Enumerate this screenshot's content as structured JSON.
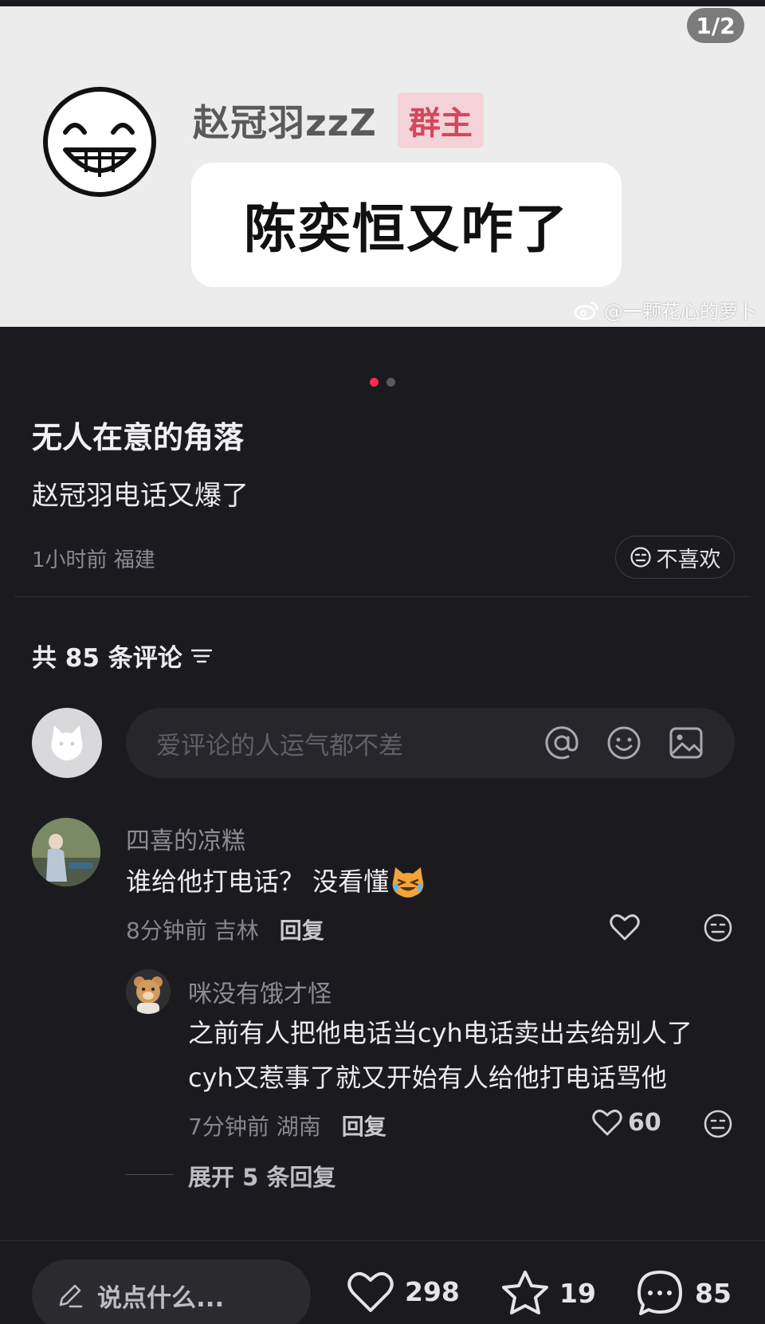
{
  "carousel": {
    "page_counter": "1/2",
    "meme": {
      "name": "赵冠羽zzZ",
      "badge": "群主",
      "bubble_text": "陈奕恒又咋了",
      "watermark": "@一颗花心的萝卜"
    },
    "dot_count": 2,
    "active_dot": 0
  },
  "post": {
    "title": "无人在意的角落",
    "body": "赵冠羽电话又爆了",
    "meta": "1小时前 福建",
    "dislike_label": "不喜欢"
  },
  "comments_header": {
    "label": "共 85 条评论"
  },
  "comment_input": {
    "placeholder": "爱评论的人运气都不差"
  },
  "comments": [
    {
      "author": "四喜的凉糕",
      "text": "谁给他打电话？ 没看懂",
      "time": "8分钟前 吉林",
      "reply": "回复",
      "likes": "",
      "emoji": "cat-crying-laughing-emoji"
    }
  ],
  "replies": [
    {
      "author": "咪没有饿才怪",
      "line1": "之前有人把他电话当cyh电话卖出去给别人了",
      "line2": "cyh又惹事了就又开始有人给他打电话骂他",
      "time": "7分钟前 湖南",
      "reply": "回复",
      "likes": "60"
    }
  ],
  "expand": {
    "label": "展开 5 条回复"
  },
  "bottom_bar": {
    "say_placeholder": "说点什么...",
    "likes": "298",
    "favorites": "19",
    "comments": "85"
  },
  "colors": {
    "background": "#1b1b1f",
    "accent": "#ff2d4a",
    "badge_text": "#d2485e"
  }
}
